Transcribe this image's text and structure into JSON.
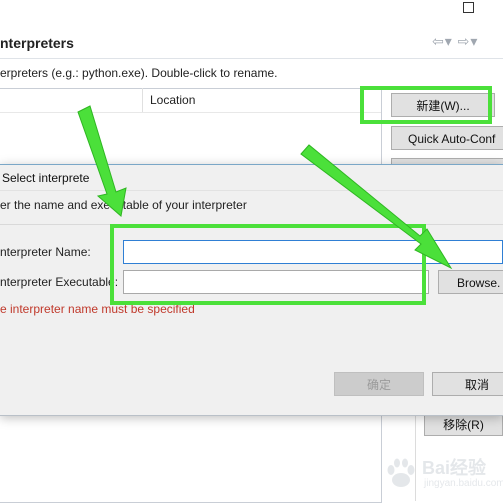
{
  "page": {
    "title": "nterpreters",
    "description": "erpreters (e.g.: python.exe).   Double-click to rename.",
    "table": {
      "column_location": "Location"
    },
    "buttons": {
      "new": "新建(W)...",
      "quick_auto_config": "Quick Auto-Conf",
      "remove": "移除(R)"
    }
  },
  "dialog": {
    "title": "Select interprete",
    "instruction": "er the name and executable of your interpreter",
    "name_label": "nterpreter Name:",
    "name_value": "",
    "executable_label": "nterpreter Executable:",
    "executable_value": "",
    "browse": "Browse.",
    "error": "e interpreter name must be specified",
    "ok": "确定",
    "cancel": "取消"
  },
  "colors": {
    "highlight": "#4be03a",
    "error": "#c0392b",
    "focus_border": "#2f7fd4"
  },
  "watermark": {
    "brand": "Bai",
    "suffix": "经验",
    "url": "jingyan.baidu.com"
  }
}
